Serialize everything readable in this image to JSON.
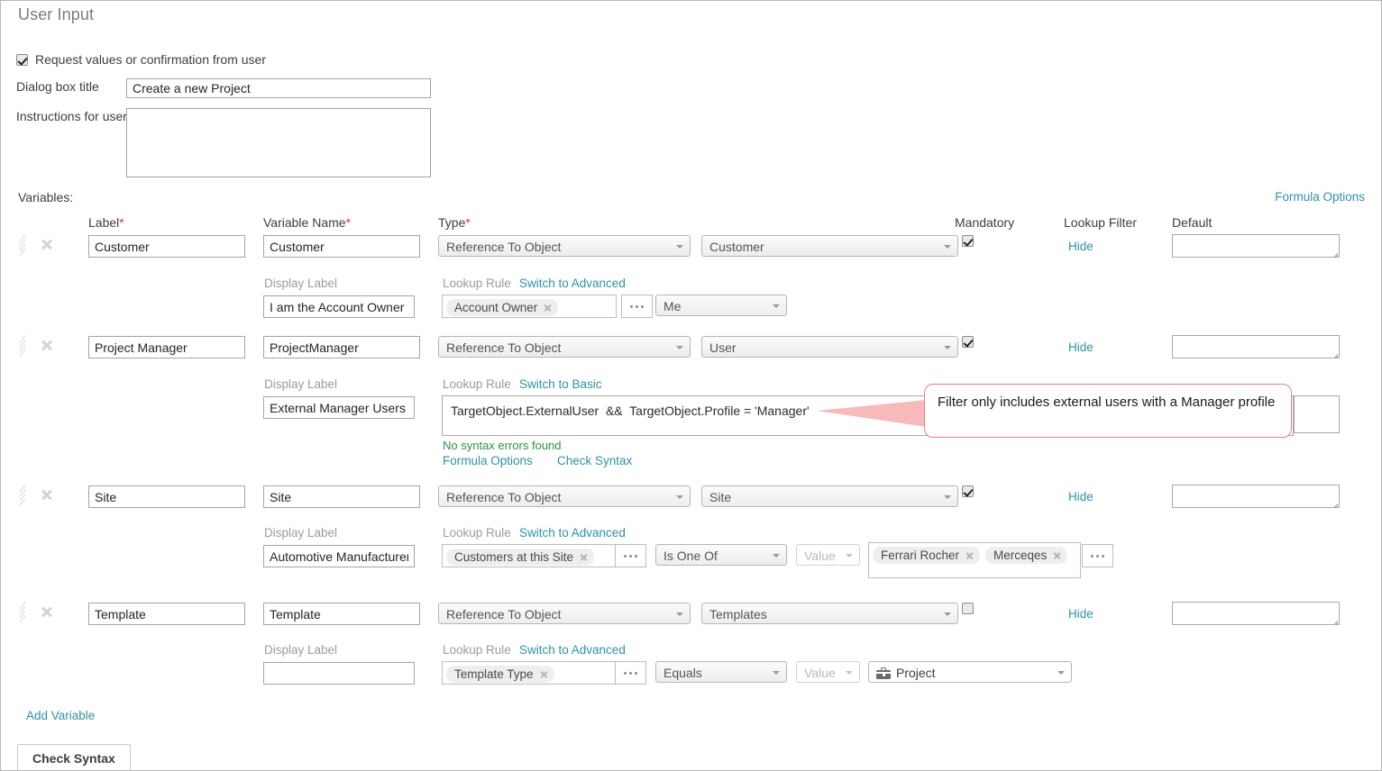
{
  "page": {
    "title": "User Input",
    "request_checkbox_label": "Request values or confirmation from user",
    "request_checkbox_checked": true,
    "dialog_title_label": "Dialog box title",
    "dialog_title_value": "Create a new Project",
    "instructions_label": "Instructions for user",
    "instructions_value": "",
    "variables_label": "Variables:",
    "formula_options_link": "Formula Options",
    "add_variable_link": "Add Variable",
    "check_syntax_button": "Check Syntax"
  },
  "columns": {
    "label": "Label",
    "variable_name": "Variable Name",
    "type": "Type",
    "mandatory": "Mandatory",
    "lookup_filter": "Lookup Filter",
    "default": "Default",
    "required_marker": "*"
  },
  "common": {
    "display_label": "Display Label",
    "lookup_rule": "Lookup Rule",
    "switch_to_advanced": "Switch to Advanced",
    "switch_to_basic": "Switch to Basic",
    "hide": "Hide",
    "ellipsis": "...",
    "value_placeholder": "Value"
  },
  "rows": [
    {
      "label": "Customer",
      "variable_name": "Customer",
      "type": "Reference To Object",
      "object": "Customer",
      "mandatory": true,
      "lookup_filter_link": "Hide",
      "default": "",
      "display_label": "I am the Account Owner",
      "lookup_mode_link": "Switch to Advanced",
      "lookup_field_token": "Account Owner",
      "operator": "Me"
    },
    {
      "label": "Project Manager",
      "variable_name": "ProjectManager",
      "type": "Reference To Object",
      "object": "User",
      "mandatory": true,
      "lookup_filter_link": "Hide",
      "default": "",
      "display_label": "External Manager Users C",
      "lookup_mode_link": "Switch to Basic",
      "formula": "TargetObject.ExternalUser  &&  TargetObject.Profile = 'Manager'",
      "syntax_status": "No syntax errors found",
      "formula_options_link": "Formula Options",
      "check_syntax_link": "Check Syntax"
    },
    {
      "label": "Site",
      "variable_name": "Site",
      "type": "Reference To Object",
      "object": "Site",
      "mandatory": true,
      "lookup_filter_link": "Hide",
      "default": "",
      "display_label": "Automotive Manufacturer",
      "lookup_mode_link": "Switch to Advanced",
      "lookup_field_token": "Customers at this Site",
      "operator": "Is One Of",
      "value_mode": "Value",
      "value_tokens": [
        "Ferrari Rocher",
        "Merceqes"
      ]
    },
    {
      "label": "Template",
      "variable_name": "Template",
      "type": "Reference To Object",
      "object": "Templates",
      "mandatory": false,
      "lookup_filter_link": "Hide",
      "default": "",
      "display_label": "",
      "lookup_mode_link": "Switch to Advanced",
      "lookup_field_token": "Template Type",
      "operator": "Equals",
      "value_mode": "Value",
      "value_selected": "Project",
      "value_icon": "briefcase-icon"
    }
  ],
  "annotation": {
    "text": "Filter only includes external users with a Manager profile",
    "border_color": "#f08080"
  }
}
